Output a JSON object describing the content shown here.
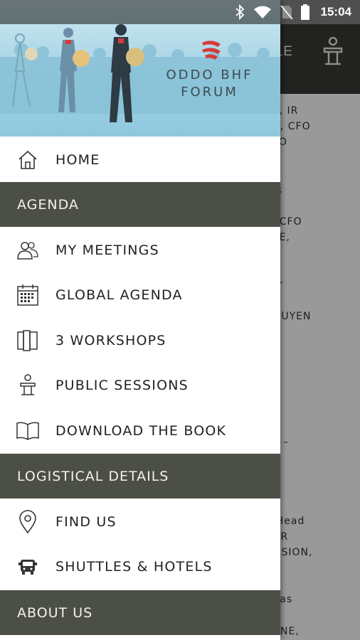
{
  "status_bar": {
    "time": "15:04",
    "icons": [
      "bluetooth-icon",
      "wifi-icon",
      "no-sim-icon",
      "battery-icon"
    ]
  },
  "background_screen": {
    "toolbar_title_fragment": "ULE",
    "toolbar_icon": "podium-icon",
    "text_fragments": [
      "LD, IR",
      "UX, CFO",
      "CFO",
      "tus",
      "E, CFO",
      "ERE,",
      "der",
      "NGUYEN",
      "FO",
      "UP –",
      "–",
      "', Head",
      "& IR",
      "ONSION,",
      "thias",
      "ANNE,"
    ]
  },
  "drawer": {
    "header": {
      "logo_line1": "ODDO BHF",
      "logo_line2": "FORUM",
      "logo_icon": "oddo-bhf-logo-icon"
    },
    "home": {
      "label": "HOME",
      "icon": "home-icon"
    },
    "sections": {
      "agenda": {
        "title": "AGENDA"
      },
      "logistics": {
        "title": "LOGISTICAL DETAILS"
      },
      "about": {
        "title": "ABOUT US"
      }
    },
    "agenda_items": [
      {
        "label": "MY MEETINGS",
        "icon": "people-icon"
      },
      {
        "label": "GLOBAL AGENDA",
        "icon": "calendar-icon"
      },
      {
        "label": "3 WORKSHOPS",
        "icon": "workshops-icon"
      },
      {
        "label": "PUBLIC SESSIONS",
        "icon": "podium-icon"
      },
      {
        "label": "DOWNLOAD THE BOOK",
        "icon": "book-icon"
      }
    ],
    "logistics_items": [
      {
        "label": "FIND US",
        "icon": "location-pin-icon"
      },
      {
        "label": "SHUTTLES & HOTELS",
        "icon": "bus-icon"
      }
    ]
  },
  "colors": {
    "section_bg": "#4b4f46",
    "toolbar_bg": "#3a3a36",
    "header_sky": "#a9d6e6",
    "logo_red": "#d63a3a"
  }
}
